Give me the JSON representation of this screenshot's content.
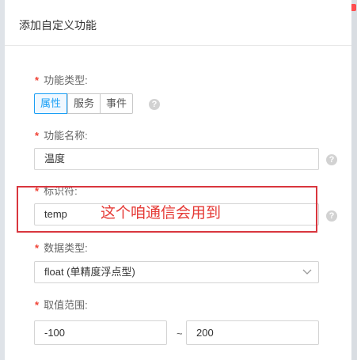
{
  "dialog": {
    "title": "添加自定义功能"
  },
  "form": {
    "function_type": {
      "label": "功能类型:",
      "options": [
        "属性",
        "服务",
        "事件"
      ],
      "selected": "属性"
    },
    "function_name": {
      "label": "功能名称:",
      "value": "温度"
    },
    "identifier": {
      "label": "标识符:",
      "value": "temp"
    },
    "data_type": {
      "label": "数据类型:",
      "value": "float (单精度浮点型)"
    },
    "value_range": {
      "label": "取值范围:",
      "min": "-100",
      "separator": "~",
      "max": "200"
    },
    "required_mark": "*",
    "help_glyph": "?"
  },
  "annotation": {
    "text": "这个咱通信会用到",
    "color": "#e53935"
  },
  "colors": {
    "accent": "#1a9ff5",
    "required": "#f04134",
    "highlight_border": "#d9363e"
  }
}
